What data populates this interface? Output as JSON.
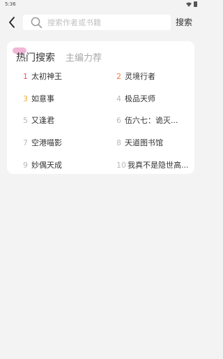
{
  "status_bar": {
    "time": "5:36"
  },
  "header": {
    "search_placeholder": "搜索作者或书籍",
    "search_value": "",
    "search_button_label": "搜索"
  },
  "tabs": [
    {
      "label": "热门搜索",
      "active": true
    },
    {
      "label": "主编力荐",
      "active": false
    }
  ],
  "hot_list": [
    {
      "rank": "1",
      "title": "太初神王",
      "rank_color": "#e8546a"
    },
    {
      "rank": "2",
      "title": "灵境行者",
      "rank_color": "#f07a3e"
    },
    {
      "rank": "3",
      "title": "如意事",
      "rank_color": "#f2b230"
    },
    {
      "rank": "4",
      "title": "极品天师",
      "rank_color": "#b8b8b8"
    },
    {
      "rank": "5",
      "title": "又逢君",
      "rank_color": "#b8b8b8"
    },
    {
      "rank": "6",
      "title": "伍六七：诡灭...",
      "rank_color": "#b8b8b8"
    },
    {
      "rank": "7",
      "title": "空港喵影",
      "rank_color": "#b8b8b8"
    },
    {
      "rank": "8",
      "title": "天道图书馆",
      "rank_color": "#b8b8b8"
    },
    {
      "rank": "9",
      "title": "妙偶天成",
      "rank_color": "#b8b8b8"
    },
    {
      "rank": "10",
      "title": "我真不是隐世高...",
      "rank_color": "#b8b8b8"
    }
  ],
  "colors": {
    "background": "#f3f3f3",
    "card": "#ffffff",
    "tab_accent": "#f0b6d6"
  },
  "icons": [
    "chevron-left-icon",
    "search-icon",
    "wifi-icon",
    "battery-icon"
  ]
}
